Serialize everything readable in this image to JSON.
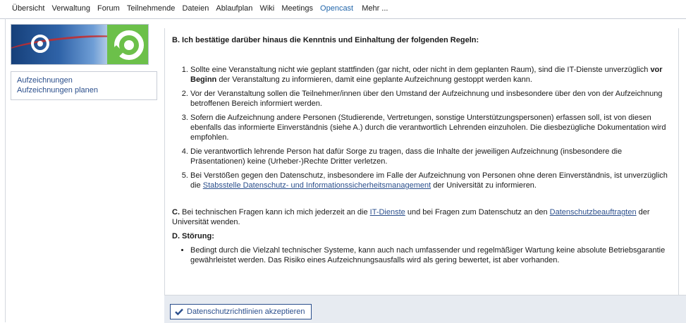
{
  "topnav": {
    "tabs": [
      "Übersicht",
      "Verwaltung",
      "Forum",
      "Teilnehmende",
      "Dateien",
      "Ablaufplan",
      "Wiki",
      "Meetings",
      "Opencast"
    ],
    "active_tab": "Opencast",
    "more_label": "Mehr ..."
  },
  "sidebar": {
    "logo_icon": "opencast-logo",
    "links": [
      "Aufzeichnungen",
      "Aufzeichnungen planen"
    ]
  },
  "content": {
    "section_b_title": "B. Ich bestätige darüber hinaus die Kenntnis und Einhaltung der folgenden Regeln:",
    "rule1_text": "Sollte eine Veranstaltung nicht wie geplant stattfinden (gar nicht, oder nicht in dem geplanten Raum), sind die IT-Dienste unverzüglich ",
    "rule1_bold": "vor Beginn",
    "rule1_text2": " der Veranstaltung zu informieren, damit eine geplante Aufzeichnung gestoppt werden kann.",
    "rule2": "Vor der Veranstaltung sollen die Teilnehmer/innen über den Umstand der Aufzeichnung und insbesondere über den von der Aufzeichnung betroffenen Bereich informiert werden.",
    "rule3": "Sofern die Aufzeichnung andere Personen (Studierende, Vertretungen, sonstige Unterstützungspersonen) erfassen soll, ist von diesen ebenfalls das informierte Einverständnis (siehe A.) durch die verantwortlich Lehrenden einzuholen. Die diesbezügliche Dokumentation wird empfohlen.",
    "rule4": "Die verantwortlich lehrende Person hat dafür Sorge zu tragen, dass die Inhalte der jeweiligen Aufzeichnung (insbesondere die Präsentationen) keine (Urheber-)Rechte Dritter verletzen.",
    "rule5_text": "Bei Verstößen gegen den Datenschutz, insbesondere im Falle der Aufzeichnung von Personen ohne deren Einverständnis, ist unverzüglich die ",
    "rule5_link": "Stabsstelle Datenschutz- und Informationssicherheitsmanagement",
    "rule5_text2": " der Universität zu informieren.",
    "c_label": "C.",
    "c_text1": " Bei technischen Fragen kann ich mich jederzeit an die ",
    "c_link1": "IT-Dienste",
    "c_text2": " und bei Fragen zum Datenschutz an den ",
    "c_link2": "Datenschutzbeauftragten",
    "c_text3": " der Universität wenden.",
    "d_title": "D. Störung:",
    "d_item": "Bedingt durch die Vielzahl technischer Systeme, kann auch nach umfassender und regelmäßiger Wartung keine absolute Betriebsgarantie gewährleistet werden. Das Risiko eines Aufzeichnungsausfalls wird als gering bewertet, ist aber vorhanden."
  },
  "footer": {
    "accept_button": "Datenschutzrichtlinien akzeptieren",
    "accept_icon": "check-icon"
  }
}
